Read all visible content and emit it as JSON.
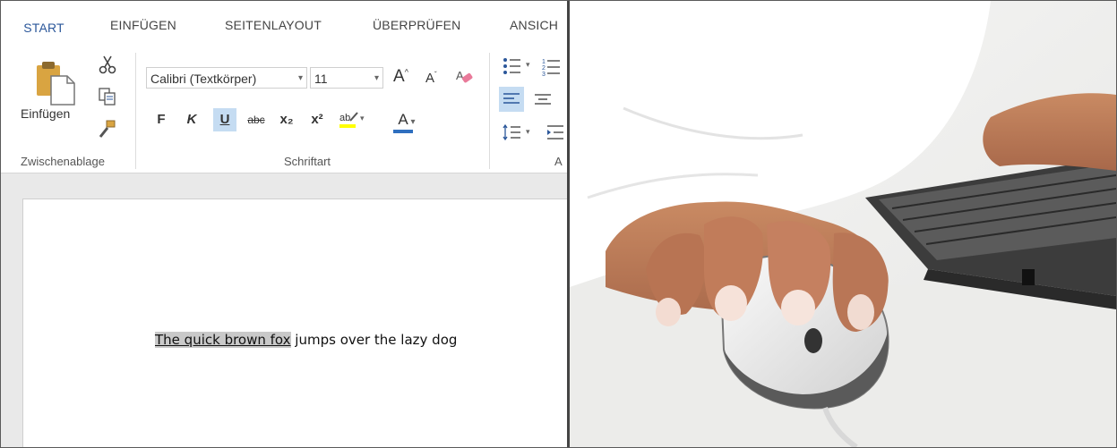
{
  "ribbon": {
    "tabs": [
      {
        "label": "START"
      },
      {
        "label": "EINFÜGEN"
      },
      {
        "label": "SEITENLAYOUT"
      },
      {
        "label": "ÜBERPRÜFEN"
      },
      {
        "label": "ANSICH"
      }
    ],
    "clipboard": {
      "paste_label": "Einfügen",
      "group_label": "Zwischenablage"
    },
    "font": {
      "font_name": "Calibri (Textkörper)",
      "font_size": "11",
      "bold_label": "F",
      "italic_label": "K",
      "underline_label": "U",
      "strike_label": "abc",
      "subscript_label": "x₂",
      "superscript_label": "x²",
      "font_color_label": "A",
      "group_label": "Schriftart"
    },
    "paragraph": {
      "group_label_partial": "A"
    }
  },
  "document": {
    "selected_text": "The quick brown fox",
    "rest_text": " jumps over the lazy dog"
  },
  "colors": {
    "accent": "#2b579a",
    "selection": "#c9c9c9",
    "active_button": "#c5dcf2",
    "highlight_yellow": "#ffff00",
    "font_color_underline": "#2f6fbf"
  }
}
